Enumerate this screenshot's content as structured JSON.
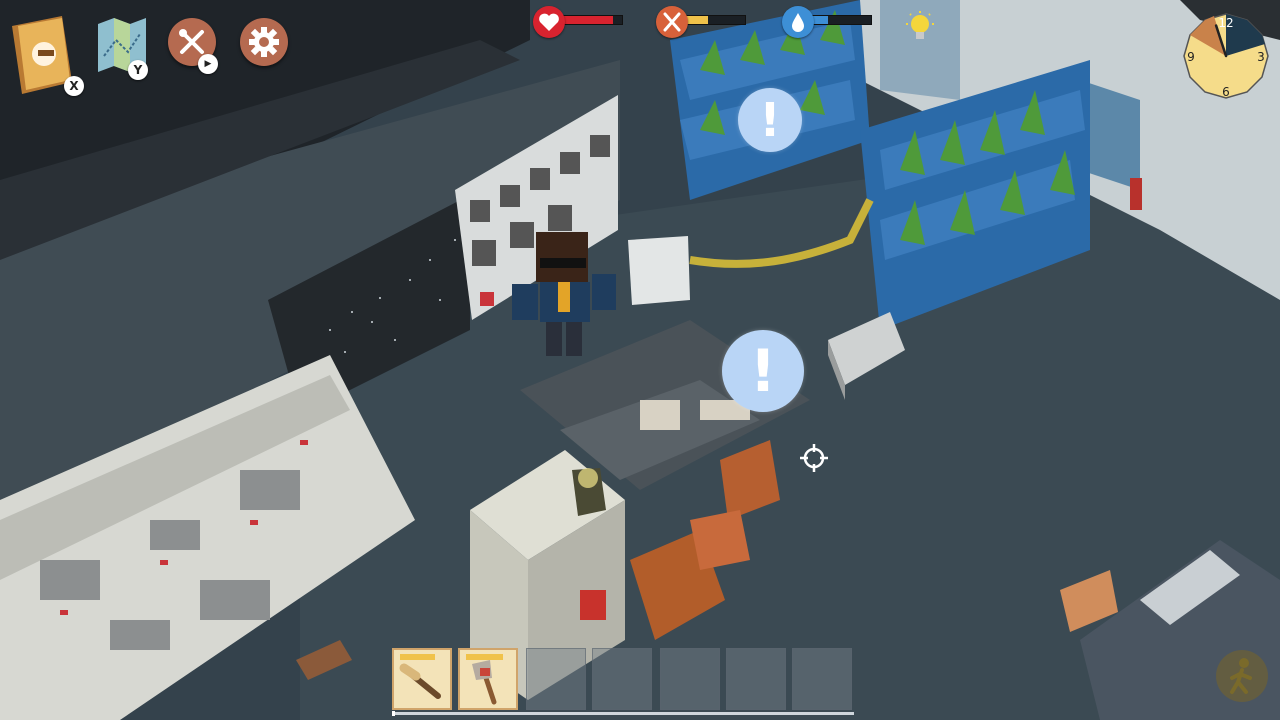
{
  "hud": {
    "buttons": [
      {
        "name": "journal",
        "icon": "journal-book-icon",
        "badge": "X"
      },
      {
        "name": "map",
        "icon": "map-icon",
        "badge": "Y"
      },
      {
        "name": "crafting",
        "icon": "crafting-tools-icon",
        "badge": "▶"
      },
      {
        "name": "settings",
        "icon": "gear-icon",
        "badge": ""
      }
    ],
    "stats": [
      {
        "name": "health",
        "icon": "heart-icon",
        "level": 0.85,
        "color": "#d8232f",
        "icon_bg": "#d8232f"
      },
      {
        "name": "hunger",
        "icon": "fork-knife-icon",
        "level": 0.4,
        "color": "#f0c24a",
        "icon_bg": "#d8613a"
      },
      {
        "name": "thirst",
        "icon": "water-drop-icon",
        "level": 0.3,
        "color": "#3d8fd6",
        "icon_bg": "#3d8fd6"
      }
    ],
    "light_icon": "light-bulb-icon",
    "clock": {
      "labels": {
        "n12": "12",
        "n3": "3",
        "n6": "6",
        "n9": "9"
      },
      "face_color": "#f5dc8a",
      "night_color": "#1f3a4d",
      "dusk_color": "#c9824a",
      "hand_hour": 11.4
    }
  },
  "alerts": [
    {
      "name": "alert-plant-rack",
      "symbol": "!"
    },
    {
      "name": "alert-workbench",
      "symbol": "!"
    }
  ],
  "crosshair_icon": "crosshair-icon",
  "hotbar": {
    "slots": [
      {
        "item": "torch-icon",
        "durability": 0.8
      },
      {
        "item": "stone-axe-icon",
        "durability": 0.85
      },
      {
        "item": "",
        "durability": 0
      },
      {
        "item": "",
        "durability": 0
      },
      {
        "item": "",
        "durability": 0
      },
      {
        "item": "",
        "durability": 0
      },
      {
        "item": "",
        "durability": 0
      }
    ]
  },
  "sneak_icon": "sneak-walk-icon",
  "colors": {
    "accent_orange": "#b56a50",
    "alert_blue": "#b9d5f6",
    "hotbar_fill": "#f3e3b8"
  }
}
